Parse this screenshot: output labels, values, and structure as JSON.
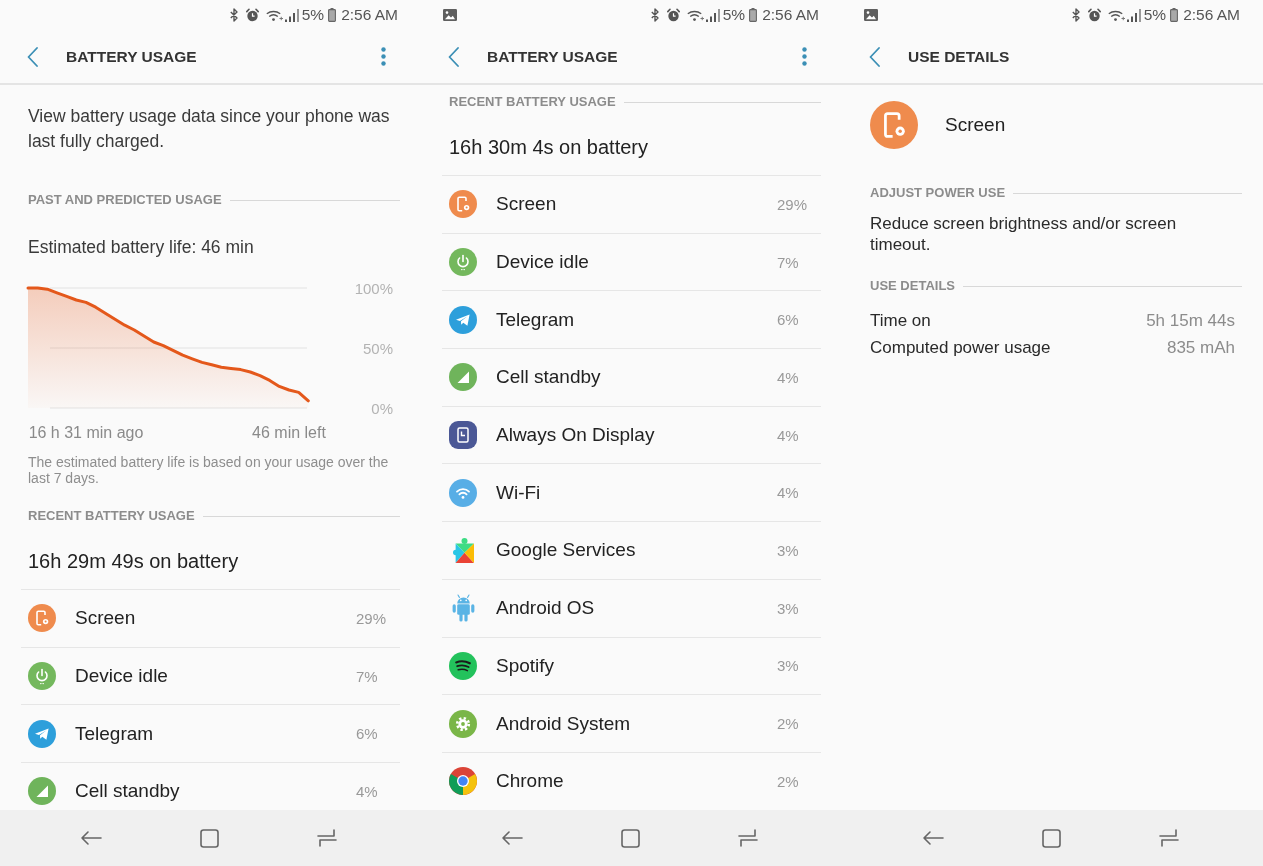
{
  "panels": [
    {
      "status_bar": {
        "image_notification": false,
        "battery": "5%",
        "time": "2:56 AM"
      },
      "header": {
        "title": "BATTERY USAGE",
        "menu": true
      },
      "blocks": [
        {
          "kind": "intro",
          "text": "View battery usage data since your phone was last fully charged."
        },
        {
          "kind": "section",
          "title": "PAST AND PREDICTED USAGE"
        },
        {
          "kind": "estimate",
          "text": "Estimated battery life: 46 min"
        },
        {
          "kind": "chart",
          "chart_data": {
            "type": "area",
            "categories": [
              null,
              null,
              null,
              null,
              null,
              null,
              "16 h 31 min ago",
              null,
              null,
              null,
              null,
              null,
              null,
              null,
              null,
              null,
              null,
              null,
              null,
              null,
              null,
              null,
              null,
              null,
              null,
              null,
              null,
              "46 min left",
              null,
              null,
              null
            ],
            "series": [
              {
                "color": "#e4581b",
                "values": [
                  100,
                  100,
                  99,
                  96,
                  93,
                  90,
                  88,
                  84,
                  79,
                  74,
                  69,
                  65,
                  60,
                  55,
                  52,
                  48,
                  44,
                  41,
                  38,
                  36,
                  34,
                  33,
                  32,
                  30,
                  27,
                  23,
                  18,
                  15,
                  13,
                  6,
                  null
                ]
              }
            ],
            "ylim": [
              0,
              100
            ],
            "yticks": [
              {
                "value": 0,
                "label": "0%"
              },
              {
                "value": 50,
                "label": "50%"
              },
              {
                "value": 100,
                "label": "100%"
              }
            ]
          }
        },
        {
          "kind": "note",
          "text": "The estimated battery life is based on your usage over the last 7 days."
        },
        {
          "kind": "section",
          "title": "RECENT BATTERY USAGE"
        },
        {
          "kind": "summary",
          "text": "16h 29m 49s on battery"
        },
        {
          "kind": "usage_list",
          "items": [
            {
              "name": "Screen",
              "percent": "29%"
            },
            {
              "name": "Device idle",
              "percent": "7%"
            },
            {
              "name": "Telegram",
              "percent": "6%"
            },
            {
              "name": "Cell standby",
              "percent": "4%"
            }
          ]
        }
      ]
    },
    {
      "status_bar": {
        "image_notification": true,
        "battery": "5%",
        "time": "2:56 AM"
      },
      "header": {
        "title": "BATTERY USAGE",
        "menu": true
      },
      "blocks": [
        {
          "kind": "section",
          "title": "RECENT BATTERY USAGE"
        },
        {
          "kind": "summary",
          "text": "16h 30m 4s on battery"
        },
        {
          "kind": "usage_list",
          "items": [
            {
              "name": "Screen",
              "percent": "29%"
            },
            {
              "name": "Device idle",
              "percent": "7%"
            },
            {
              "name": "Telegram",
              "percent": "6%"
            },
            {
              "name": "Cell standby",
              "percent": "4%"
            },
            {
              "name": "Always On Display",
              "percent": "4%"
            },
            {
              "name": "Wi-Fi",
              "percent": "4%"
            },
            {
              "name": "Google Services",
              "percent": "3%"
            },
            {
              "name": "Android OS",
              "percent": "3%"
            },
            {
              "name": "Spotify",
              "percent": "3%"
            },
            {
              "name": "Android System",
              "percent": "2%"
            },
            {
              "name": "Chrome",
              "percent": "2%"
            }
          ]
        }
      ]
    },
    {
      "status_bar": {
        "image_notification": true,
        "battery": "5%",
        "time": "2:56 AM"
      },
      "header": {
        "title": "USE DETAILS",
        "menu": false
      },
      "blocks": [
        {
          "kind": "app",
          "name": "Screen"
        },
        {
          "kind": "section",
          "title": "ADJUST POWER USE"
        },
        {
          "kind": "tip",
          "text": "Reduce screen brightness and/or screen timeout."
        },
        {
          "kind": "section",
          "title": "USE DETAILS"
        },
        {
          "kind": "details",
          "rows": [
            {
              "label": "Time on",
              "value": "5h 15m 44s"
            },
            {
              "label": "Computed power usage",
              "value": "835 mAh"
            }
          ]
        }
      ]
    }
  ]
}
